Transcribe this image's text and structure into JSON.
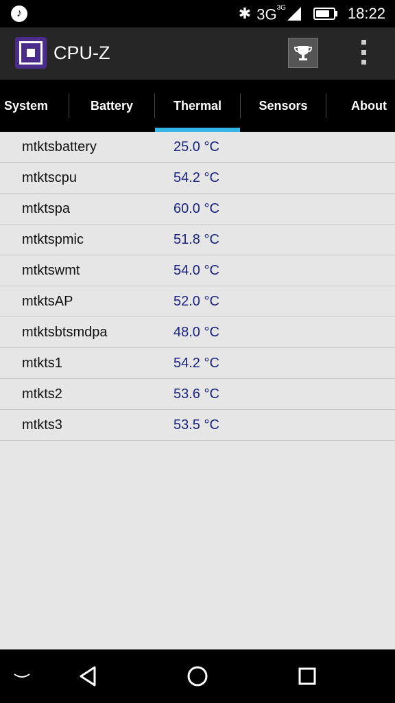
{
  "status": {
    "left_icon": "music-note-icon",
    "bluetooth_icon": "bluetooth-icon",
    "network": "3G",
    "network_sup": "3G",
    "signal_icon": "signal-icon",
    "battery_icon": "battery-icon",
    "battery_level": 0.8,
    "time": "18:22"
  },
  "app": {
    "title": "CPU-Z",
    "logo_icon": "cpu-chip-icon",
    "trophy_icon": "trophy-icon",
    "menu_icon": "overflow-menu-icon"
  },
  "tabs": [
    {
      "label": "System"
    },
    {
      "label": "Battery"
    },
    {
      "label": "Thermal"
    },
    {
      "label": "Sensors"
    },
    {
      "label": "About"
    }
  ],
  "active_tab": "Thermal",
  "accent_color": "#33b5e5",
  "value_color": "#1a237e",
  "thermal": [
    {
      "name": "mtktsbattery",
      "value": "25.0 °C"
    },
    {
      "name": "mtktscpu",
      "value": "54.2 °C"
    },
    {
      "name": "mtktspa",
      "value": "60.0 °C"
    },
    {
      "name": "mtktspmic",
      "value": "51.8 °C"
    },
    {
      "name": "mtktswmt",
      "value": "54.0 °C"
    },
    {
      "name": "mtktsAP",
      "value": "52.0 °C"
    },
    {
      "name": "mtktsbtsmdpa",
      "value": "48.0 °C"
    },
    {
      "name": "mtkts1",
      "value": "54.2 °C"
    },
    {
      "name": "mtkts2",
      "value": "53.6 °C"
    },
    {
      "name": "mtkts3",
      "value": "53.5 °C"
    }
  ],
  "nav": {
    "hide_icon": "chevron-down-icon",
    "back_icon": "back-triangle-icon",
    "home_icon": "home-circle-icon",
    "recents_icon": "recents-square-icon"
  }
}
